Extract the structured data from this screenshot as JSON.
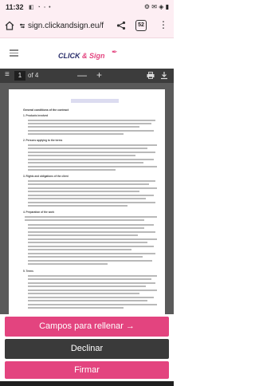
{
  "status_bar": {
    "time": "11:32",
    "left_icons": "◧ ◔ ◦ •",
    "right_icons": "⚙ ✉ ◈ ▮"
  },
  "browser": {
    "url": "sign.clickandsign.eu/f",
    "tab_count": "52",
    "menu_glyph": "⋮"
  },
  "app": {
    "brand_part1": "CLICK",
    "brand_amp": " & ",
    "brand_part2": "Sign"
  },
  "pdf_toolbar": {
    "menu_glyph": "≡",
    "current_page": "1",
    "page_of": "of 4",
    "zoom_out_glyph": "—",
    "zoom_in_glyph": "+"
  },
  "document": {
    "heading": "General conditions of the contract",
    "sections": [
      "1. Products involved",
      "2. Persons applying to the terms",
      "3. Rights and obligations of the client",
      "4. Preparation of the work",
      "5. Terms"
    ]
  },
  "actions": {
    "fields_label": "Campos para rellenar →",
    "decline_label": "Declinar",
    "sign_label": "Firmar"
  },
  "colors": {
    "accent": "#e3447f",
    "brand_navy": "#2a2e6b",
    "decline_bg": "#3a3a3a",
    "pdf_toolbar_bg": "#3c3c3c"
  }
}
